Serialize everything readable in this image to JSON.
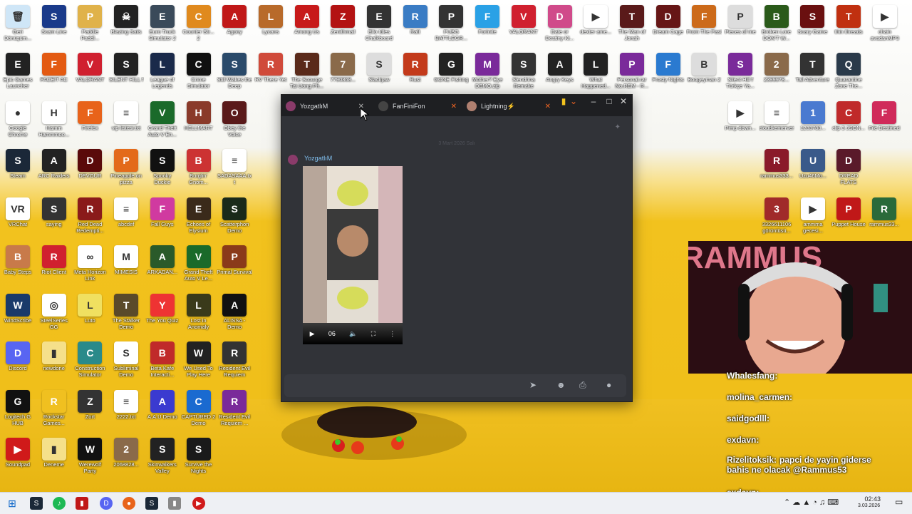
{
  "desktop_icons": [
    {
      "label": "Geri Dönüşüm...",
      "color": "#cfe6f7",
      "glyph": "🗑"
    },
    {
      "label": "Scam Line",
      "color": "#1a3a8a",
      "glyph": "S"
    },
    {
      "label": "Paddle Paddl...",
      "color": "#e0b24a",
      "glyph": "P"
    },
    {
      "label": "Blazing Sails",
      "color": "#222",
      "glyph": "☠"
    },
    {
      "label": "Euro Truck Simulator 2",
      "color": "#3a4a5a",
      "glyph": "E"
    },
    {
      "label": "Counter Str... 2",
      "color": "#e08a1e",
      "glyph": "C"
    },
    {
      "label": "Agony",
      "color": "#c01818",
      "glyph": "A"
    },
    {
      "label": "Lycans",
      "color": "#b86a2a",
      "glyph": "L"
    },
    {
      "label": "Among Us",
      "color": "#c71a1a",
      "glyph": "A"
    },
    {
      "label": "Zenithmail",
      "color": "#b31212",
      "glyph": "Z"
    },
    {
      "label": "Ello Idles Chalkboard",
      "color": "#333",
      "glyph": "E"
    },
    {
      "label": "Raft",
      "color": "#3a7cc4",
      "glyph": "R"
    },
    {
      "label": "PUBG BATTLEGR...",
      "color": "#333",
      "glyph": "P"
    },
    {
      "label": "Fortnite",
      "color": "#2aa1e6",
      "glyph": "F"
    },
    {
      "label": "VALORANT",
      "color": "#d0202f",
      "glyph": "V"
    },
    {
      "label": "Date or Destiny Ki...",
      "color": "#d04a8a",
      "glyph": "D"
    },
    {
      "label": "dexter ame...",
      "color": "#fff",
      "glyph": "▶"
    },
    {
      "label": "The Man of Jonah",
      "color": "#5a1a1a",
      "glyph": "T"
    },
    {
      "label": "Dream Cage",
      "color": "#661616",
      "glyph": "D"
    },
    {
      "label": "From The Past",
      "color": "#cc6a1a",
      "glyph": "F"
    },
    {
      "label": "Pieces of me",
      "color": "#ddd",
      "glyph": "P"
    },
    {
      "label": "Broken Lore DON'T W...",
      "color": "#2a5a1a",
      "glyph": "B"
    },
    {
      "label": "Scary Game",
      "color": "#6a1010",
      "glyph": "S"
    },
    {
      "label": "thin threads",
      "color": "#c03010",
      "glyph": "T"
    },
    {
      "label": "chain avadanMP3",
      "color": "#fff",
      "glyph": "▶"
    },
    {
      "label": "Epic Games Launcher",
      "color": "#222",
      "glyph": "E"
    },
    {
      "label": "FACEIT AC",
      "color": "#e35a12",
      "glyph": "F"
    },
    {
      "label": "VALORANT",
      "color": "#d0202f",
      "glyph": "V"
    },
    {
      "label": "SILENT HILL f",
      "color": "#222",
      "glyph": "S"
    },
    {
      "label": "League of Legends",
      "color": "#1a2a4a",
      "glyph": "L"
    },
    {
      "label": "Crime Simulator",
      "color": "#111",
      "glyph": "C"
    },
    {
      "label": "Still Wakes the Deep",
      "color": "#2a4a6a",
      "glyph": "S"
    },
    {
      "label": "RV There Yet",
      "color": "#d04a3a",
      "glyph": "R"
    },
    {
      "label": "The Scourge Tai Uong Ph...",
      "color": "#5a2a1a",
      "glyph": "T"
    },
    {
      "label": "7790868...",
      "color": "#8a6a4a",
      "glyph": "7"
    },
    {
      "label": "Slackjaw",
      "color": "#ddd",
      "glyph": "S"
    },
    {
      "label": "Rust",
      "color": "#c33a1a",
      "glyph": "R"
    },
    {
      "label": "GONE Fishing",
      "color": "#222",
      "glyph": "G"
    },
    {
      "label": "Mother? Eye DEMO.zip",
      "color": "#7a2a9a",
      "glyph": "M"
    },
    {
      "label": "Slendrina Remake",
      "color": "#333",
      "glyph": "S"
    },
    {
      "label": "Angry Keys",
      "color": "#222",
      "glyph": "A"
    },
    {
      "label": "What Happened...",
      "color": "#222",
      "glyph": "L"
    },
    {
      "label": "Personal.rar No.REM - R...",
      "color": "#7a2a9a",
      "glyph": "P"
    },
    {
      "label": "Frosty Nights",
      "color": "#2a7ad0",
      "glyph": "F"
    },
    {
      "label": "Boogeyman 2",
      "color": "#ddd",
      "glyph": "B"
    },
    {
      "label": "Silent Hill f Türkçe Ya...",
      "color": "#7a2a9a",
      "glyph": "S"
    },
    {
      "label": "2399978...",
      "color": "#8a6a4a",
      "glyph": "2"
    },
    {
      "label": "Tall Adventure",
      "color": "#333",
      "glyph": "T"
    },
    {
      "label": "Quarantine Zone The...",
      "color": "#2a3a4a",
      "glyph": "Q"
    },
    {
      "label": "Google Chrome",
      "color": "#fff",
      "glyph": "●"
    },
    {
      "label": "Hamm Hammmoo...",
      "color": "#fff",
      "glyph": "H"
    },
    {
      "label": "Firefox",
      "color": "#e8631a",
      "glyph": "F"
    },
    {
      "label": "vip listesi.txt",
      "color": "#fff",
      "glyph": "≡"
    },
    {
      "label": "Grand Theft Auto V En...",
      "color": "#1a6a2a",
      "glyph": "V"
    },
    {
      "label": "HELLMART",
      "color": "#8a3a2a",
      "glyph": "H"
    },
    {
      "label": "Obey the Voice",
      "color": "#5a1a1a",
      "glyph": "O"
    },
    {
      "label": "Steam",
      "color": "#1b2838",
      "glyph": "S"
    },
    {
      "label": "ARC Raiders",
      "color": "#222",
      "glyph": "A"
    },
    {
      "label": "DEVOUR",
      "color": "#5a0a0a",
      "glyph": "D"
    },
    {
      "label": "Pineapple on pizza",
      "color": "#e36a1a",
      "glyph": "P"
    },
    {
      "label": "Spooky Duckie",
      "color": "#111",
      "glyph": "S"
    },
    {
      "label": "Burglin' Gnom...",
      "color": "#c33",
      "glyph": "B"
    },
    {
      "label": "SADASAAA.txt",
      "color": "#fff",
      "glyph": "≡"
    },
    {
      "label": "VRChat",
      "color": "#fff",
      "glyph": "VR"
    },
    {
      "label": "saying",
      "color": "#333",
      "glyph": "S"
    },
    {
      "label": "Red Dead Redempti...",
      "color": "#8a1a1a",
      "glyph": "R"
    },
    {
      "label": "abcdef",
      "color": "#fff",
      "glyph": "≡"
    },
    {
      "label": "Fall Guys",
      "color": "#d03aa0",
      "glyph": "F"
    },
    {
      "label": "Echoes of Elysium",
      "color": "#3a2a1a",
      "glyph": "E"
    },
    {
      "label": "Scatterphon Demo",
      "color": "#1a2a1a",
      "glyph": "S"
    },
    {
      "label": "Baby Steps",
      "color": "#c87a4a",
      "glyph": "B"
    },
    {
      "label": "Riot Client",
      "color": "#d0202f",
      "glyph": "R"
    },
    {
      "label": "Meta Horizon Link",
      "color": "#fff",
      "glyph": "∞"
    },
    {
      "label": "MIMESIS",
      "color": "#fff",
      "glyph": "M"
    },
    {
      "label": "ARKADAN...",
      "color": "#2a5a2a",
      "glyph": "A"
    },
    {
      "label": "Grand Theft Auto V Le...",
      "color": "#1a6a2a",
      "glyph": "V"
    },
    {
      "label": "Primal Survival",
      "color": "#8a3a1a",
      "glyph": "P"
    },
    {
      "label": "WindScribe",
      "color": "#1a3a6a",
      "glyph": "W"
    },
    {
      "label": "SteelSeries GG",
      "color": "#fff",
      "glyph": "◎"
    },
    {
      "label": "Luto",
      "color": "#f0e060",
      "glyph": "L"
    },
    {
      "label": "The Stalker Demo",
      "color": "#5a4a2a",
      "glyph": "T"
    },
    {
      "label": "The You Quiz",
      "color": "#e33",
      "glyph": "Y"
    },
    {
      "label": "Lost in Anomaly",
      "color": "#3a3a1a",
      "glyph": "L"
    },
    {
      "label": "ALISSA - Demo",
      "color": "#111",
      "glyph": "A"
    },
    {
      "label": "Discord",
      "color": "#5865f2",
      "glyph": "D"
    },
    {
      "label": "newdone",
      "color": "#f5e08a",
      "glyph": "▮"
    },
    {
      "label": "Construction Simulator",
      "color": "#2a8a8a",
      "glyph": "C"
    },
    {
      "label": "Subliminal Demo",
      "color": "#fff",
      "glyph": "S"
    },
    {
      "label": "Beta Kafe Interacti...",
      "color": "#c02a2a",
      "glyph": "B"
    },
    {
      "label": "We Used To Play Here",
      "color": "#222",
      "glyph": "W"
    },
    {
      "label": "Resident Evil Requiem",
      "color": "#333",
      "glyph": "R"
    },
    {
      "label": "Logitech G HUB",
      "color": "#111",
      "glyph": "G"
    },
    {
      "label": "Rockstar Games...",
      "color": "#f0c020",
      "glyph": "R"
    },
    {
      "label": "Zort",
      "color": "#333",
      "glyph": "Z"
    },
    {
      "label": "2222.txt",
      "color": "#fff",
      "glyph": "≡"
    },
    {
      "label": "A.A.U Demo",
      "color": "#3a3ad0",
      "glyph": "A"
    },
    {
      "label": "CAPTURED 2 Demo",
      "color": "#1a6ad0",
      "glyph": "C"
    },
    {
      "label": "Resident Evil Requiem ...",
      "color": "#7a2a9a",
      "glyph": "R"
    },
    {
      "label": "Soundpad",
      "color": "#d01a1a",
      "glyph": "▶"
    },
    {
      "label": "Deneme",
      "color": "#f5e08a",
      "glyph": "▮"
    },
    {
      "label": "Werewolf Party",
      "color": "#111",
      "glyph": "W"
    },
    {
      "label": "2068828...",
      "color": "#8a6a4a",
      "glyph": "2"
    },
    {
      "label": "Skinwalkers Valley",
      "color": "#222",
      "glyph": "S"
    },
    {
      "label": "Survive the Nights",
      "color": "#1a1a1a",
      "glyph": "S"
    }
  ],
  "right_icons": [
    {
      "label": "Pimp down...",
      "color": "#fff",
      "glyph": "▶"
    },
    {
      "label": "cloudkemerver",
      "color": "#fff",
      "glyph": "≡"
    },
    {
      "label": "1233788...",
      "color": "#4a7ad0",
      "glyph": "1"
    },
    {
      "label": "clip 3 JSON...",
      "color": "#c02a2a",
      "glyph": "C"
    },
    {
      "label": "File Destined",
      "color": "#d02a5a",
      "glyph": "F"
    },
    {
      "label": "rammus333...",
      "color": "#8a1a2a",
      "glyph": "R"
    },
    {
      "label": "Uzu46Mo...",
      "color": "#3a5a8a",
      "glyph": "U"
    },
    {
      "label": "DREAD FLATS",
      "color": "#5a1a2a",
      "glyph": "D"
    },
    {
      "label": "3326611106 görüntüsü...",
      "color": "#a02a2a",
      "glyph": "3"
    },
    {
      "label": "ammma gecesi...",
      "color": "#fff",
      "glyph": "▶"
    },
    {
      "label": "Puppet House",
      "color": "#c01818",
      "glyph": "P"
    },
    {
      "label": "rammus33...",
      "color": "#2a6a3a",
      "glyph": "R"
    }
  ],
  "discord": {
    "tabs": [
      {
        "label": "YozgatlıM"
      },
      {
        "label": "FanFiniFon"
      },
      {
        "label": "Lightning⚡"
      }
    ],
    "date_divider": "3 Mart 2026 Salı",
    "message_user": "YozgatlıM",
    "video_time": "06"
  },
  "chat": [
    {
      "user": "Whalesfang:",
      "text": ""
    },
    {
      "user": "molina_carmen:",
      "text": ""
    },
    {
      "user": "saidgodlll:",
      "text": ""
    },
    {
      "user": "exdavn:",
      "text": ""
    },
    {
      "user": "Rizelitoksik:",
      "text": "papci de yayin giderse bahis ne olacak @Rammus53"
    },
    {
      "user": "exdavn:",
      "text": ""
    }
  ],
  "clock": {
    "time": "02:43",
    "date": "3.03.2026"
  }
}
